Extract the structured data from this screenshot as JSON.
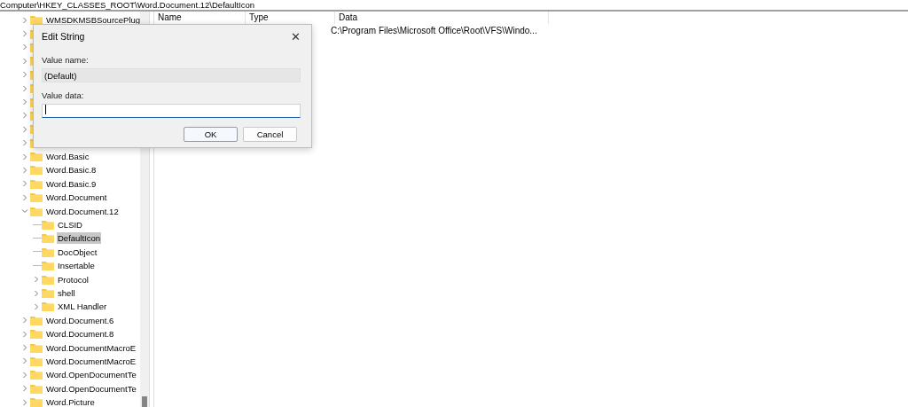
{
  "address_bar": {
    "path": "Computer\\HKEY_CLASSES_ROOT\\Word.Document.12\\DefaultIcon"
  },
  "tree": {
    "items": [
      {
        "label": "WMSDKMSBSourcePlug",
        "expanded": false,
        "selected": false
      },
      {
        "expanded": false
      },
      {
        "expanded": false
      },
      {
        "expanded": false
      },
      {
        "expanded": false
      },
      {
        "expanded": false
      },
      {
        "expanded": false
      },
      {
        "expanded": false
      },
      {
        "expanded": false
      },
      {
        "expanded": false
      },
      {
        "label": "Word.Basic",
        "expanded": false,
        "selected": false
      },
      {
        "label": "Word.Basic.8",
        "expanded": false,
        "selected": false
      },
      {
        "label": "Word.Basic.9",
        "expanded": false,
        "selected": false
      },
      {
        "label": "Word.Document",
        "expanded": false,
        "selected": false
      },
      {
        "label": "Word.Document.12",
        "expanded": true,
        "selected": false,
        "children": [
          {
            "label": "CLSID",
            "has_children": false,
            "selected": false
          },
          {
            "label": "DefaultIcon",
            "has_children": false,
            "selected": true
          },
          {
            "label": "DocObject",
            "has_children": false,
            "selected": false
          },
          {
            "label": "Insertable",
            "has_children": false,
            "selected": false
          },
          {
            "label": "Protocol",
            "has_children": true,
            "selected": false
          },
          {
            "label": "shell",
            "has_children": true,
            "selected": false
          },
          {
            "label": "XML Handler",
            "has_children": true,
            "selected": false
          }
        ]
      },
      {
        "label": "Word.Document.6",
        "expanded": false,
        "selected": false
      },
      {
        "label": "Word.Document.8",
        "expanded": false,
        "selected": false
      },
      {
        "label": "Word.DocumentMacroE",
        "expanded": false,
        "selected": false
      },
      {
        "label": "Word.DocumentMacroE",
        "expanded": false,
        "selected": false
      },
      {
        "label": "Word.OpenDocumentTe",
        "expanded": false,
        "selected": false
      },
      {
        "label": "Word.OpenDocumentTe",
        "expanded": false,
        "selected": false
      },
      {
        "label": "Word.Picture",
        "expanded": false,
        "selected": false
      }
    ]
  },
  "values": {
    "columns": [
      "Name",
      "Type",
      "Data"
    ],
    "rows": [
      {
        "data": "C:\\Program Files\\Microsoft Office\\Root\\VFS\\Windo..."
      }
    ]
  },
  "dialog": {
    "title": "Edit String",
    "close": "✕",
    "value_name_label": "Value name:",
    "value_name": "(Default)",
    "value_data_label": "Value data:",
    "value_data_focused": true,
    "buttons": [
      {
        "label": "OK",
        "default": true
      },
      {
        "label": "Cancel",
        "default": false
      }
    ]
  }
}
